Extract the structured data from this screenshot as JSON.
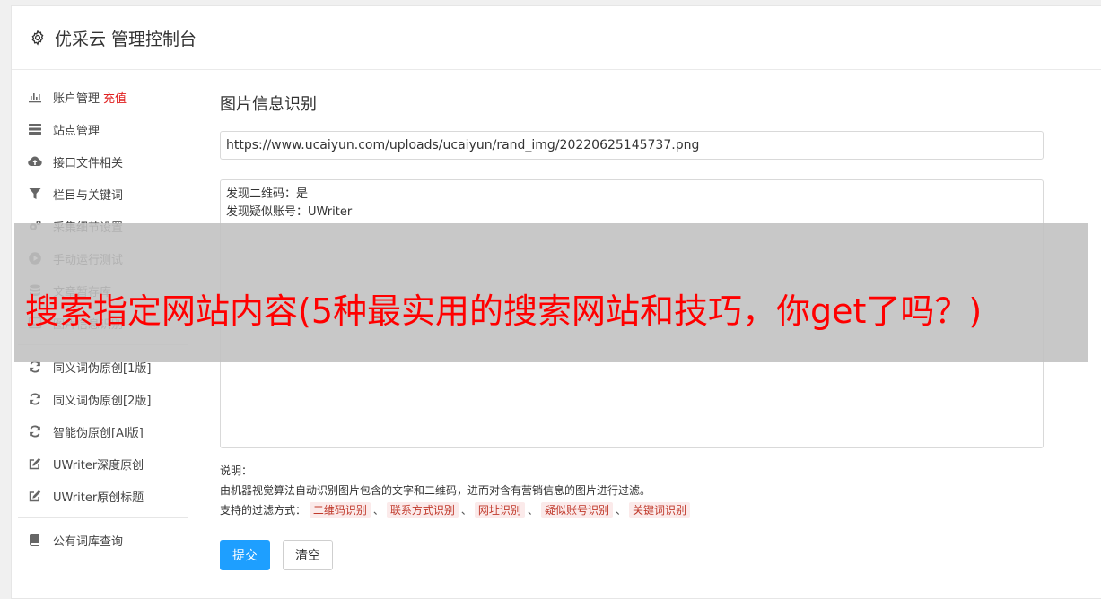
{
  "header": {
    "title": "优采云 管理控制台",
    "icon": "gear-icon"
  },
  "sidebar": {
    "groups": [
      [
        {
          "label": "账户管理",
          "extra": "充值",
          "icon": "bar-chart-icon"
        },
        {
          "label": "站点管理",
          "icon": "server-icon"
        },
        {
          "label": "接口文件相关",
          "icon": "cloud-upload-icon"
        },
        {
          "label": "栏目与关键词",
          "icon": "filter-icon"
        },
        {
          "label": "采集细节设置",
          "icon": "cogs-icon"
        },
        {
          "label": "手动运行测试",
          "icon": "play-circle-icon"
        },
        {
          "label": "文章暂存库",
          "icon": "database-icon"
        },
        {
          "label": "图片信息识别",
          "icon": "image-icon"
        }
      ],
      [
        {
          "label": "同义词伪原创[1版]",
          "icon": "refresh-icon"
        },
        {
          "label": "同义词伪原创[2版]",
          "icon": "refresh-icon"
        },
        {
          "label": "智能伪原创[AI版]",
          "icon": "refresh-icon"
        },
        {
          "label": "UWriter深度原创",
          "icon": "edit-icon"
        },
        {
          "label": "UWriter原创标题",
          "icon": "edit-icon"
        }
      ],
      [
        {
          "label": "公有词库查询",
          "icon": "book-icon"
        }
      ]
    ]
  },
  "main": {
    "title": "图片信息识别",
    "url_value": "https://www.ucaiyun.com/uploads/ucaiyun/rand_img/20220625145737.png",
    "result_text": "发现二维码：是\n发现疑似账号：UWriter",
    "desc": {
      "heading": "说明：",
      "line1": "由机器视觉算法自动识别图片包含的文字和二维码，进而对含有营销信息的图片进行过滤。",
      "filters_label": "支持的过滤方式：",
      "filters": [
        "二维码识别",
        "联系方式识别",
        "网址识别",
        "疑似账号识别",
        "关键词识别"
      ],
      "separator": "、"
    },
    "buttons": {
      "submit": "提交",
      "clear": "清空"
    }
  },
  "overlay": {
    "text": "搜索指定网站内容(5种最实用的搜索网站和技巧，你get了吗？)"
  },
  "colors": {
    "primary": "#1e9fff",
    "danger": "#e02020",
    "overlay_text": "#ff0000"
  }
}
